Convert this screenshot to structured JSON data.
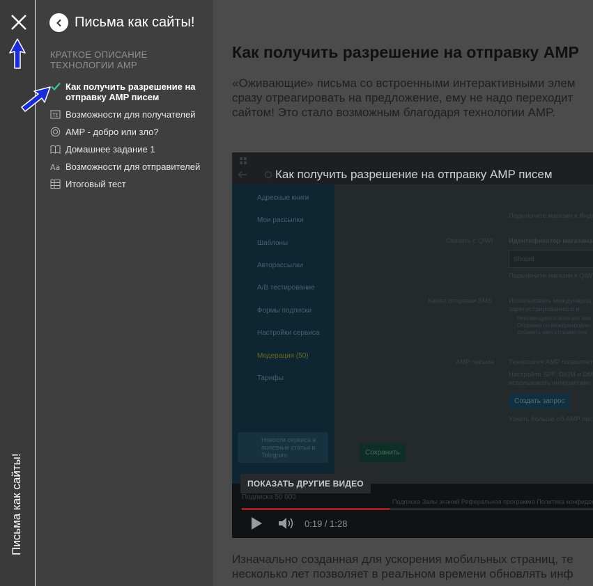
{
  "rail": {
    "title": "Письма как сайты!"
  },
  "sidebar": {
    "title": "Письма как сайты!",
    "section_heading": "Краткое описание технологии AMP",
    "lessons": [
      {
        "label": "Как получить разрешение на отправку AMP писем",
        "icon": "check-icon",
        "active": true
      },
      {
        "label": "Возможности для получателей",
        "icon": "text-box-icon"
      },
      {
        "label": "AMP - добро или зло?",
        "icon": "target-icon"
      },
      {
        "label": "Домашнее задание 1",
        "icon": "book-icon"
      },
      {
        "label": "Возможности для отправителей",
        "icon": "font-icon"
      },
      {
        "label": "Итоговый тест",
        "icon": "quiz-grid-icon"
      }
    ]
  },
  "article": {
    "title": "Как получить разрешение на отправку AMP",
    "intro_lines": [
      "«Оживающие» письма со встроенными интерактивными элем",
      "сразу отреагировать на предложение, ему не надо переходит",
      "сайтом! Это стало возможным благодаря технологии AMP."
    ],
    "outro_lines": [
      "Изначально созданная для ускорения мобильных страниц, те",
      "несколько лет позволяет в реальном времени обновлять инф"
    ]
  },
  "video": {
    "title": "Как получить разрешение на отправку AMP писем",
    "more_videos": "ПОКАЗАТЬ ДРУГИЕ ВИДЕО",
    "time": "0:19 / 1:28",
    "progress": 0.42,
    "subscription": "Подписка 50 000",
    "footer_links": "Подписка   Залы знаний   Реферальная программа   Политика конфиденц",
    "nav_items": [
      "Адресные книги",
      "Мои рассылки",
      "Шаблоны",
      "Авторассылки",
      "A/B тестирование",
      "Формы подписки",
      "Настройки сервиса",
      "Модерация (50)",
      "Тарифы"
    ],
    "telegram_note": "Новости сервиса в полезные статьи в Telegram",
    "panel": {
      "qiwi_label": "Связать с QIWI",
      "shop_id_label": "Идентификатор магазина",
      "shop_id_placeholder": "Shopld",
      "connect_hint_1": "Подключите магазин к Яндекс",
      "connect_hint_2": "Подключите магазин к QIWI",
      "sms_label": "Канал отправки SMS",
      "sms_option": "Использовать международ зарегистрированного и",
      "sms_hint": "Рекомендуется если нет вои Отправка по международны добавить имя отправителя",
      "amp_label": "AMP письма",
      "amp_text_1": "Технология AMP позволяет",
      "amp_text_2": "Настройте SPF, DKIM и DMA использовать интерактивн",
      "create_request": "Создать запрос",
      "learn_more": "Узнать больше об AMP пис",
      "save": "Сохранить"
    }
  },
  "colors": {
    "accent_check": "#37c8a0",
    "annotation_arrow": "#1a2bdc",
    "progress": "#a1201f"
  }
}
